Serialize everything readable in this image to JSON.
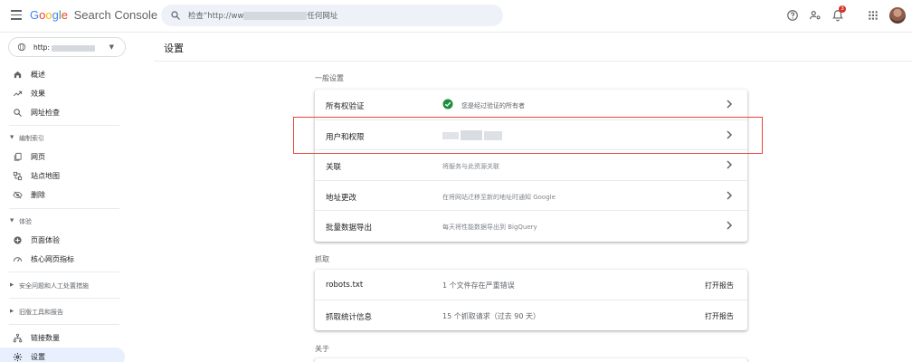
{
  "header": {
    "logo_google": [
      "G",
      "o",
      "o",
      "g",
      "l",
      "e"
    ],
    "logo_product": "Search Console",
    "search_prefix": "检查“http://ww",
    "search_suffix": "任何网址",
    "notification_count": "3"
  },
  "sidebar": {
    "property_label": "http:",
    "items_top": [
      {
        "label": "概述",
        "icon": "home-icon"
      },
      {
        "label": "效果",
        "icon": "trending-up-icon"
      },
      {
        "label": "网址检查",
        "icon": "search-icon"
      }
    ],
    "section_index": "编制索引",
    "items_index": [
      {
        "label": "网页",
        "icon": "file-copy-icon"
      },
      {
        "label": "站点地图",
        "icon": "sitemap-icon"
      },
      {
        "label": "删除",
        "icon": "visibility-off-icon"
      }
    ],
    "section_experience": "体验",
    "items_experience": [
      {
        "label": "页面体验",
        "icon": "plus-circle-icon"
      },
      {
        "label": "核心网页指标",
        "icon": "speed-icon"
      }
    ],
    "section_security": "安全问题和人工处置措施",
    "section_legacy": "旧版工具和报告",
    "items_bottom": [
      {
        "label": "链接数量",
        "icon": "links-icon"
      },
      {
        "label": "设置",
        "icon": "gear-icon"
      }
    ]
  },
  "main": {
    "page_title": "设置",
    "general_section": "一般设置",
    "general_rows": [
      {
        "label": "所有权验证",
        "desc": "您是经过验证的所有者"
      },
      {
        "label": "用户和权限",
        "desc": ""
      },
      {
        "label": "关联",
        "desc": "将服务与此资源关联"
      },
      {
        "label": "地址更改",
        "desc": "在将网站迁移至新的地址时通知 Google"
      },
      {
        "label": "批量数据导出",
        "desc": "每天将性能数据导出到 BigQuery"
      }
    ],
    "crawl_section": "抓取",
    "crawl_rows": [
      {
        "label": "robots.txt",
        "desc": "1 个文件存在严重错误",
        "action": "打开报告"
      },
      {
        "label": "抓取统计信息",
        "desc": "15 个抓取请求（过去 90 天）",
        "action": "打开报告"
      }
    ],
    "about_section": "关于"
  },
  "colors": {
    "accent": "#1a73e8",
    "active_bg": "#e8f0fe",
    "success": "#1e8e3e",
    "highlight": "#e8453c"
  }
}
